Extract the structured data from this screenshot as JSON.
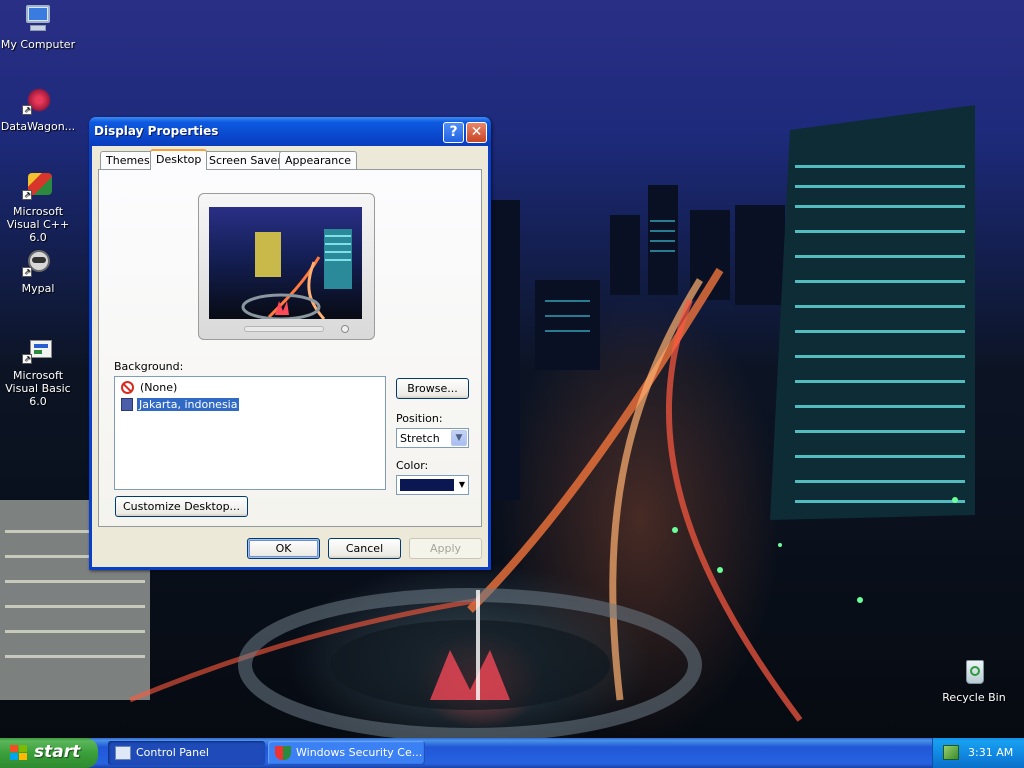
{
  "desktop": {
    "icons": [
      {
        "label": "My Computer"
      },
      {
        "label": "DataWagon..."
      },
      {
        "label": "Microsoft Visual C++ 6.0"
      },
      {
        "label": "Mypal"
      },
      {
        "label": "Microsoft Visual Basic 6.0"
      },
      {
        "label": "Recycle Bin"
      }
    ]
  },
  "window": {
    "title": "Display Properties",
    "help_glyph": "?",
    "close_glyph": "✕",
    "tabs": [
      {
        "label": "Themes"
      },
      {
        "label": "Desktop"
      },
      {
        "label": "Screen Saver"
      },
      {
        "label": "Appearance"
      }
    ],
    "active_tab": "Desktop",
    "background_label": "Background:",
    "background_items": [
      {
        "label": "(None)"
      },
      {
        "label": "Jakarta, indonesia"
      }
    ],
    "selected_background": "Jakarta, indonesia",
    "browse_label": "Browse...",
    "position_label": "Position:",
    "position_value": "Stretch",
    "color_label": "Color:",
    "color_value": "#0b1753",
    "customize_label": "Customize Desktop...",
    "ok_label": "OK",
    "cancel_label": "Cancel",
    "apply_label": "Apply"
  },
  "taskbar": {
    "start_label": "start",
    "tasks": [
      {
        "label": "Control Panel"
      },
      {
        "label": "Windows Security Ce..."
      }
    ],
    "clock": "3:31 AM"
  }
}
